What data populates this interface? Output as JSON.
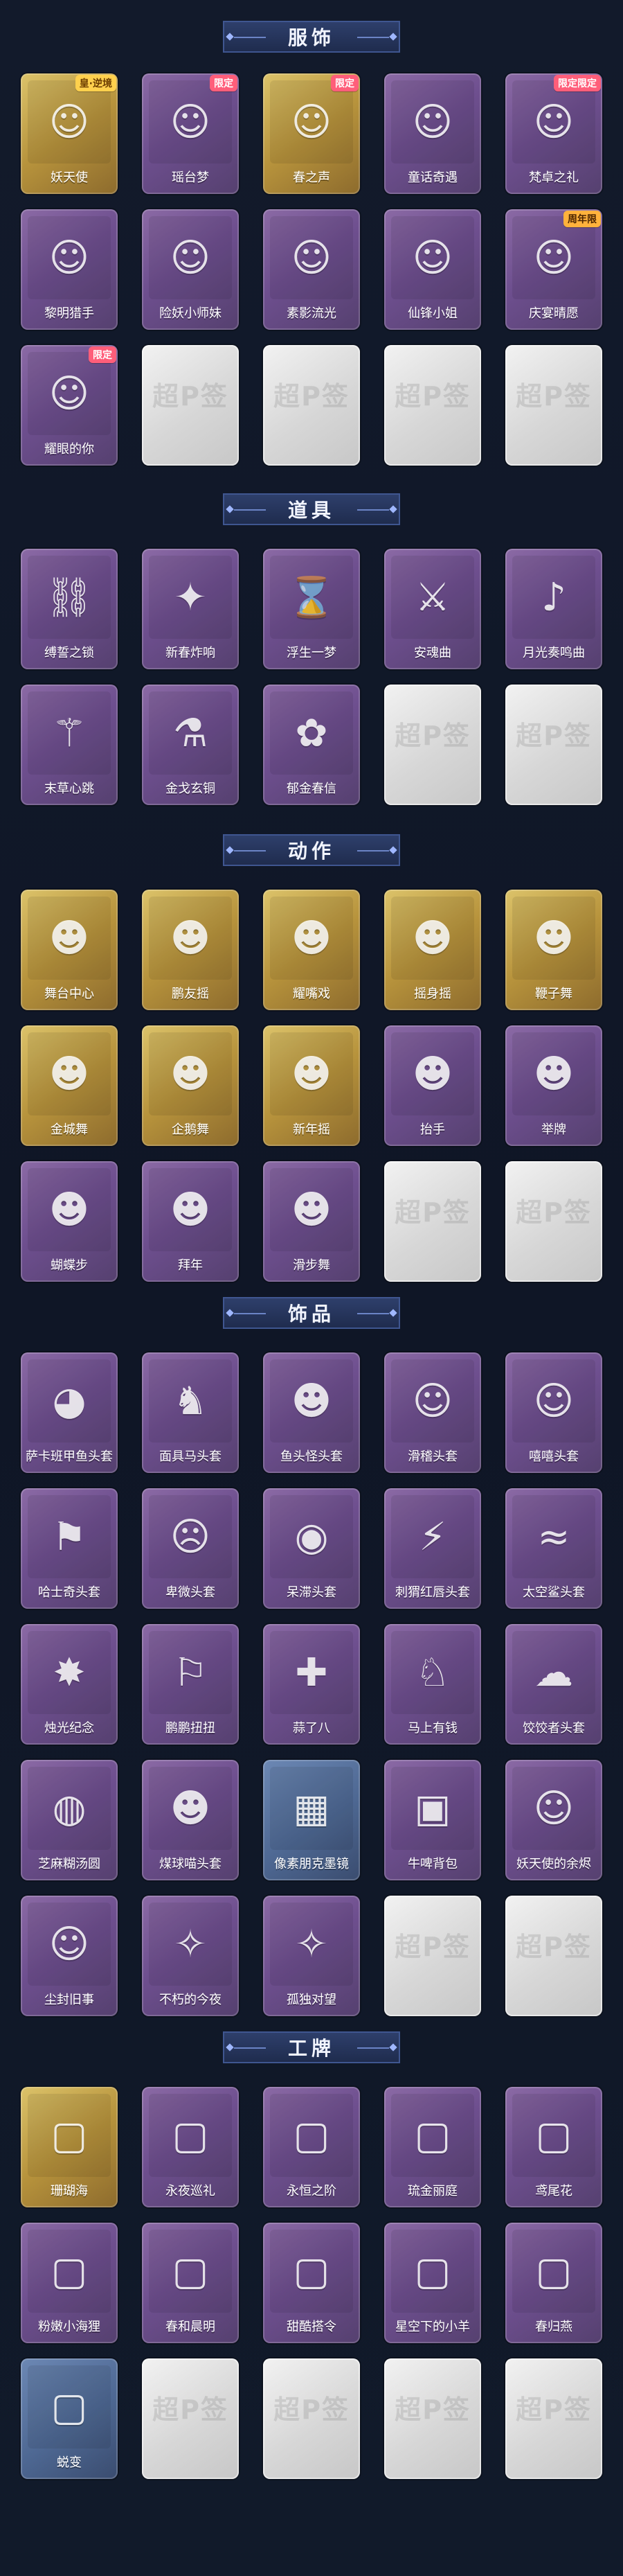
{
  "sections": [
    {
      "title": "服饰",
      "items": [
        {
          "label": "妖天使",
          "frame": "gold",
          "icon": "character-portrait",
          "tag": "皇·逆境"
        },
        {
          "label": "瑶台梦",
          "frame": "purple",
          "icon": "character-portrait",
          "tag": "限定"
        },
        {
          "label": "春之声",
          "frame": "gold",
          "icon": "character-portrait",
          "tag": "限定"
        },
        {
          "label": "童话奇遇",
          "frame": "purple",
          "icon": "character-portrait",
          "tag": ""
        },
        {
          "label": "梵卓之礼",
          "frame": "purple",
          "icon": "character-portrait",
          "tag": "限定限定"
        },
        {
          "label": "黎明猎手",
          "frame": "purple",
          "icon": "character-portrait",
          "tag": ""
        },
        {
          "label": "险妖小师妹",
          "frame": "purple",
          "icon": "character-portrait",
          "tag": ""
        },
        {
          "label": "素影流光",
          "frame": "purple",
          "icon": "character-portrait",
          "tag": ""
        },
        {
          "label": "仙锋小姐",
          "frame": "purple",
          "icon": "character-portrait",
          "tag": ""
        },
        {
          "label": "庆宴晴愿",
          "frame": "purple",
          "icon": "character-portrait",
          "tag": "周年限"
        },
        {
          "label": "耀眼的你",
          "frame": "purple",
          "icon": "character-portrait",
          "tag": "限定"
        },
        {
          "label": "",
          "frame": "empty",
          "icon": "empty-slot",
          "tag": ""
        },
        {
          "label": "",
          "frame": "empty",
          "icon": "empty-slot",
          "tag": ""
        },
        {
          "label": "",
          "frame": "empty",
          "icon": "empty-slot",
          "tag": ""
        },
        {
          "label": "",
          "frame": "empty",
          "icon": "empty-slot",
          "tag": ""
        }
      ]
    },
    {
      "title": "道具",
      "items": [
        {
          "label": "缚誓之锁",
          "frame": "purple",
          "icon": "chain-item",
          "tag": ""
        },
        {
          "label": "新春炸响",
          "frame": "purple",
          "icon": "firecracker-item",
          "tag": ""
        },
        {
          "label": "浮生一梦",
          "frame": "purple",
          "icon": "hourglass-item",
          "tag": ""
        },
        {
          "label": "安魂曲",
          "frame": "purple",
          "icon": "weapon-item",
          "tag": ""
        },
        {
          "label": "月光奏鸣曲",
          "frame": "purple",
          "icon": "piano-item",
          "tag": ""
        },
        {
          "label": "末草心跳",
          "frame": "purple",
          "icon": "staff-item",
          "tag": ""
        },
        {
          "label": "金戈玄铜",
          "frame": "purple",
          "icon": "lantern-item",
          "tag": ""
        },
        {
          "label": "郁金春信",
          "frame": "purple",
          "icon": "fan-item",
          "tag": ""
        },
        {
          "label": "",
          "frame": "empty",
          "icon": "empty-slot",
          "tag": ""
        },
        {
          "label": "",
          "frame": "empty",
          "icon": "empty-slot",
          "tag": ""
        }
      ]
    },
    {
      "title": "动作",
      "items": [
        {
          "label": "舞台中心",
          "frame": "gold",
          "icon": "emote-pose",
          "tag": ""
        },
        {
          "label": "鹏友摇",
          "frame": "gold",
          "icon": "emote-pose",
          "tag": ""
        },
        {
          "label": "耀嘴戏",
          "frame": "gold",
          "icon": "emote-pose",
          "tag": ""
        },
        {
          "label": "摇身摇",
          "frame": "gold",
          "icon": "emote-pose",
          "tag": ""
        },
        {
          "label": "鞭子舞",
          "frame": "gold",
          "icon": "emote-pose",
          "tag": ""
        },
        {
          "label": "金城舞",
          "frame": "gold",
          "icon": "emote-pose",
          "tag": ""
        },
        {
          "label": "企鹅舞",
          "frame": "gold",
          "icon": "emote-pose",
          "tag": ""
        },
        {
          "label": "新年摇",
          "frame": "gold",
          "icon": "emote-pose",
          "tag": ""
        },
        {
          "label": "抬手",
          "frame": "purple",
          "icon": "emote-pose",
          "tag": ""
        },
        {
          "label": "举牌",
          "frame": "purple",
          "icon": "emote-pose",
          "tag": ""
        },
        {
          "label": "蝴蝶步",
          "frame": "purple",
          "icon": "emote-pose",
          "tag": ""
        },
        {
          "label": "拜年",
          "frame": "purple",
          "icon": "emote-pose",
          "tag": ""
        },
        {
          "label": "滑步舞",
          "frame": "purple",
          "icon": "emote-pose",
          "tag": ""
        },
        {
          "label": "",
          "frame": "empty",
          "icon": "empty-slot",
          "tag": ""
        },
        {
          "label": "",
          "frame": "empty",
          "icon": "empty-slot",
          "tag": ""
        }
      ]
    },
    {
      "title": "饰品",
      "items": [
        {
          "label": "萨卡班甲鱼头套",
          "frame": "purple",
          "icon": "fish-head",
          "tag": ""
        },
        {
          "label": "面具马头套",
          "frame": "purple",
          "icon": "horse-head",
          "tag": ""
        },
        {
          "label": "鱼头怪头套",
          "frame": "purple",
          "icon": "frog-head",
          "tag": ""
        },
        {
          "label": "滑稽头套",
          "frame": "purple",
          "icon": "smile-emoji",
          "tag": ""
        },
        {
          "label": "嘻嘻头套",
          "frame": "purple",
          "icon": "grin-emoji",
          "tag": ""
        },
        {
          "label": "哈士奇头套",
          "frame": "purple",
          "icon": "dog-head",
          "tag": ""
        },
        {
          "label": "卑微头套",
          "frame": "purple",
          "icon": "sad-emoji",
          "tag": ""
        },
        {
          "label": "呆滞头套",
          "frame": "purple",
          "icon": "shock-emoji",
          "tag": ""
        },
        {
          "label": "刺猬红唇头套",
          "frame": "purple",
          "icon": "pikachu-head",
          "tag": ""
        },
        {
          "label": "太空鲨头套",
          "frame": "purple",
          "icon": "shark-head",
          "tag": ""
        },
        {
          "label": "烛光纪念",
          "frame": "purple",
          "icon": "candle-item",
          "tag": ""
        },
        {
          "label": "鹏鹏扭扭",
          "frame": "purple",
          "icon": "dog-plush",
          "tag": ""
        },
        {
          "label": "蒜了八",
          "frame": "purple",
          "icon": "garlic-item",
          "tag": ""
        },
        {
          "label": "马上有钱",
          "frame": "purple",
          "icon": "horse-item",
          "tag": ""
        },
        {
          "label": "饺饺者头套",
          "frame": "purple",
          "icon": "cloud-head",
          "tag": ""
        },
        {
          "label": "芝麻糊汤圆",
          "frame": "purple",
          "icon": "dumpling-head",
          "tag": ""
        },
        {
          "label": "煤球喵头套",
          "frame": "purple",
          "icon": "cat-head",
          "tag": ""
        },
        {
          "label": "像素朋克墨镜",
          "frame": "blue",
          "icon": "pixel-sunglasses",
          "tag": ""
        },
        {
          "label": "牛啤背包",
          "frame": "purple",
          "icon": "backpack",
          "tag": ""
        },
        {
          "label": "妖天使的余烬",
          "frame": "purple",
          "icon": "character-doll",
          "tag": ""
        },
        {
          "label": "尘封旧事",
          "frame": "purple",
          "icon": "character-doll",
          "tag": ""
        },
        {
          "label": "不朽的今夜",
          "frame": "purple",
          "icon": "ornament",
          "tag": ""
        },
        {
          "label": "孤独对望",
          "frame": "purple",
          "icon": "ornament",
          "tag": ""
        },
        {
          "label": "",
          "frame": "empty",
          "icon": "empty-slot",
          "tag": ""
        },
        {
          "label": "",
          "frame": "empty",
          "icon": "empty-slot",
          "tag": ""
        }
      ]
    },
    {
      "title": "工牌",
      "items": [
        {
          "label": "珊瑚海",
          "frame": "gold",
          "icon": "card-frame",
          "tag": ""
        },
        {
          "label": "永夜巡礼",
          "frame": "purple",
          "icon": "card-frame",
          "tag": ""
        },
        {
          "label": "永恒之阶",
          "frame": "purple",
          "icon": "card-frame",
          "tag": ""
        },
        {
          "label": "琉金丽庭",
          "frame": "purple",
          "icon": "card-frame",
          "tag": ""
        },
        {
          "label": "鸢尾花",
          "frame": "purple",
          "icon": "card-frame",
          "tag": ""
        },
        {
          "label": "粉嫩小海狸",
          "frame": "purple",
          "icon": "card-frame",
          "tag": ""
        },
        {
          "label": "春和晨明",
          "frame": "purple",
          "icon": "card-frame",
          "tag": ""
        },
        {
          "label": "甜酷搭令",
          "frame": "purple",
          "icon": "card-frame",
          "tag": ""
        },
        {
          "label": "星空下的小羊",
          "frame": "purple",
          "icon": "card-frame",
          "tag": ""
        },
        {
          "label": "春归燕",
          "frame": "purple",
          "icon": "card-frame",
          "tag": ""
        },
        {
          "label": "蜕变",
          "frame": "blue",
          "icon": "card-frame",
          "tag": ""
        },
        {
          "label": "",
          "frame": "empty",
          "icon": "empty-slot",
          "tag": ""
        },
        {
          "label": "",
          "frame": "empty",
          "icon": "empty-slot",
          "tag": ""
        },
        {
          "label": "",
          "frame": "empty",
          "icon": "empty-slot",
          "tag": ""
        },
        {
          "label": "",
          "frame": "empty",
          "icon": "empty-slot",
          "tag": ""
        }
      ]
    }
  ],
  "empty_slot_watermark": "超P签",
  "colors": {
    "background": "#0f1626",
    "banner": "#263762",
    "banner_border": "#3f5690",
    "frame_purple": "#7a5a9b",
    "frame_gold": "#c2a24a",
    "frame_blue": "#5a73a0",
    "frame_empty": "#dcdcdc",
    "text": "#ffffff"
  }
}
